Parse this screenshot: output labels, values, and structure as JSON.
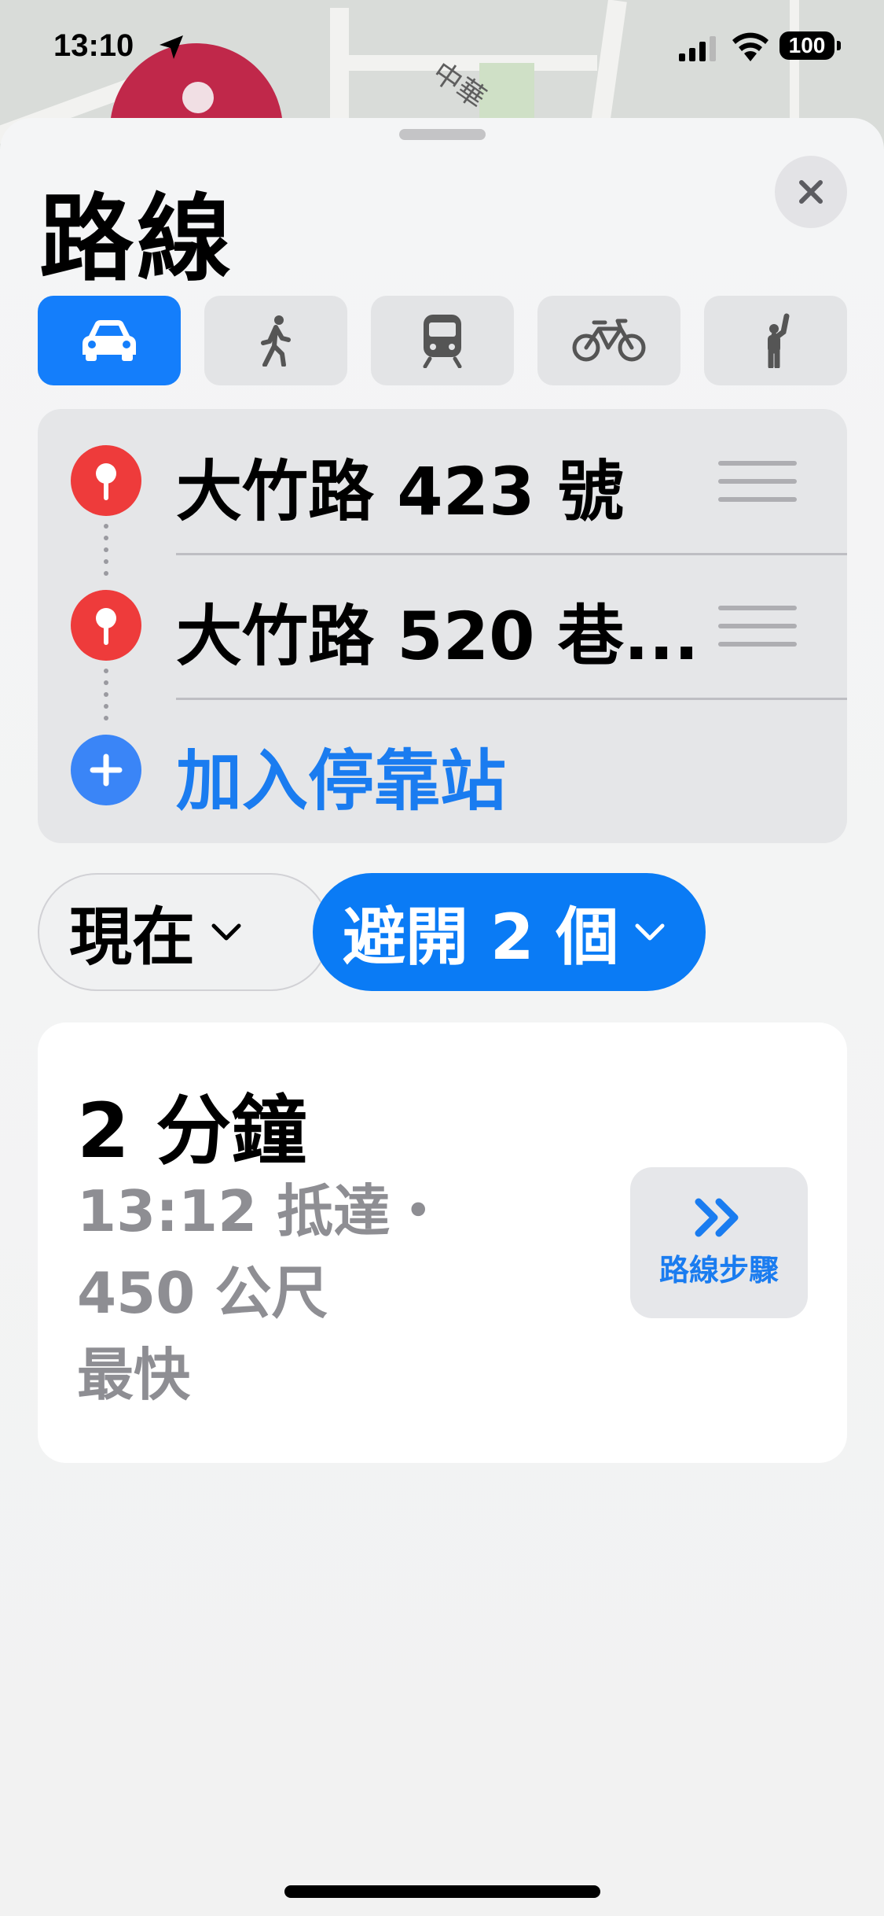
{
  "status_bar": {
    "time": "13:10",
    "battery": "100"
  },
  "map": {
    "label": "中華"
  },
  "sheet": {
    "title": "路線",
    "close_icon": "close-icon"
  },
  "transport_modes": [
    {
      "name": "car",
      "icon": "car-icon",
      "active": true
    },
    {
      "name": "walk",
      "icon": "walking-icon",
      "active": false
    },
    {
      "name": "transit",
      "icon": "train-icon",
      "active": false
    },
    {
      "name": "cycle",
      "icon": "bicycle-icon",
      "active": false
    },
    {
      "name": "rideshare",
      "icon": "hailing-person-icon",
      "active": false
    }
  ],
  "route": {
    "stops": [
      {
        "label": "大竹路 423 號"
      },
      {
        "label": "大竹路 520 巷..."
      }
    ],
    "add_stop_label": "加入停靠站"
  },
  "options": {
    "time_label": "現在",
    "avoid_label": "避開 2 個"
  },
  "result": {
    "duration": "2 分鐘",
    "details": "13:12 抵達・450 公尺",
    "tag": "最快",
    "steps_label": "路線步驟"
  },
  "colors": {
    "accent": "#147efb",
    "pin_red": "#ee3b3b",
    "secondary_text": "#8e8e93"
  }
}
